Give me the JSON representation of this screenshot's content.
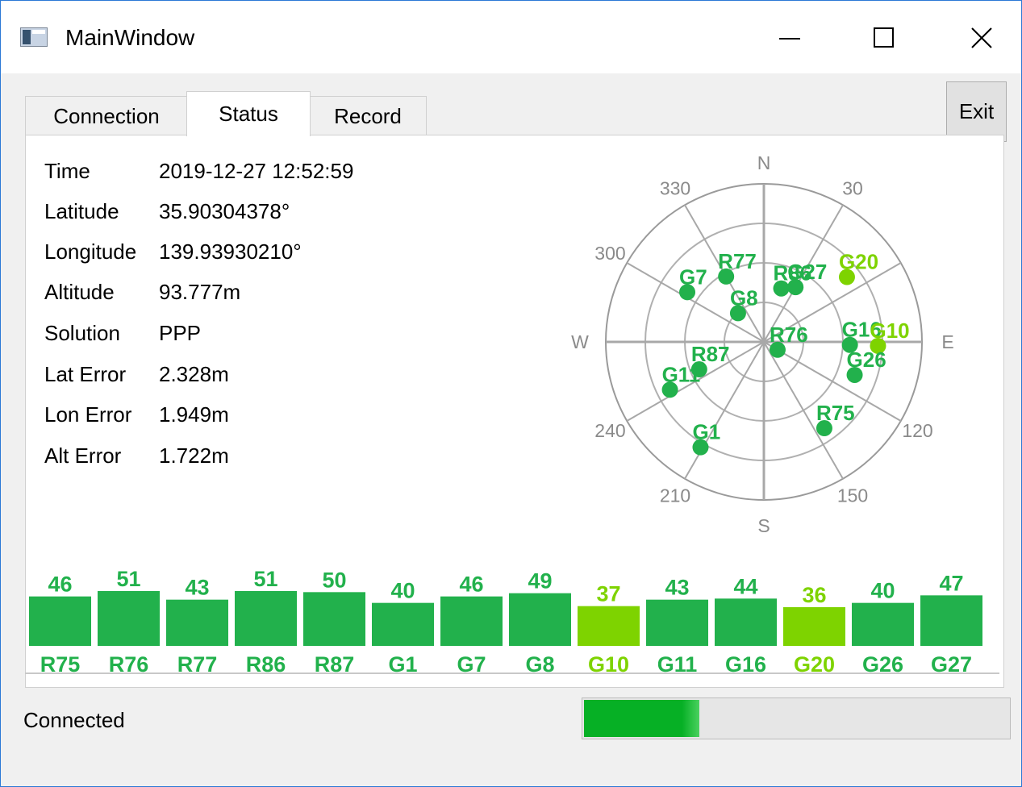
{
  "window": {
    "title": "MainWindow",
    "minimize_icon": "minimize-icon",
    "maximize_icon": "maximize-icon",
    "close_icon": "close-icon"
  },
  "tabs": [
    {
      "label": "Connection",
      "active": false
    },
    {
      "label": "Status",
      "active": true
    },
    {
      "label": "Record",
      "active": false
    }
  ],
  "exit_label": "Exit",
  "info": [
    {
      "label": "Time",
      "value": "2019-12-27 12:52:59"
    },
    {
      "label": "Latitude",
      "value": "35.90304378°"
    },
    {
      "label": "Longitude",
      "value": "139.93930210°"
    },
    {
      "label": "Altitude",
      "value": "93.777m"
    },
    {
      "label": "Solution",
      "value": "PPP"
    },
    {
      "label": "Lat Error",
      "value": "2.328m"
    },
    {
      "label": "Lon Error",
      "value": "1.949m"
    },
    {
      "label": "Alt Error",
      "value": "1.722m"
    }
  ],
  "skyplot": {
    "cardinals": {
      "N": "N",
      "E": "E",
      "S": "S",
      "W": "W"
    },
    "azimuth_labels": [
      "30",
      "120",
      "150",
      "210",
      "240",
      "300",
      "330"
    ],
    "satellites": [
      {
        "name": "R77",
        "az": 330,
        "el": 47,
        "color": "#22b14c"
      },
      {
        "name": "G7",
        "az": 303,
        "el": 38,
        "color": "#22b14c"
      },
      {
        "name": "R86",
        "az": 18,
        "el": 58,
        "color": "#22b14c"
      },
      {
        "name": "G27",
        "az": 30,
        "el": 54,
        "color": "#22b14c"
      },
      {
        "name": "G20",
        "az": 52,
        "el": 30,
        "color": "#7ed300"
      },
      {
        "name": "G8",
        "az": 318,
        "el": 68,
        "color": "#22b14c"
      },
      {
        "name": "G16",
        "az": 92,
        "el": 41,
        "color": "#22b14c"
      },
      {
        "name": "G10",
        "az": 92,
        "el": 25,
        "color": "#7ed300"
      },
      {
        "name": "R76",
        "az": 120,
        "el": 81,
        "color": "#22b14c"
      },
      {
        "name": "G26",
        "az": 110,
        "el": 35,
        "color": "#22b14c"
      },
      {
        "name": "R87",
        "az": 247,
        "el": 50,
        "color": "#22b14c"
      },
      {
        "name": "G11",
        "az": 243,
        "el": 30,
        "color": "#22b14c"
      },
      {
        "name": "R75",
        "az": 145,
        "el": 30,
        "color": "#22b14c"
      },
      {
        "name": "G1",
        "az": 211,
        "el": 20,
        "color": "#22b14c"
      }
    ]
  },
  "chart_data": {
    "type": "bar",
    "categories": [
      "R75",
      "R76",
      "R77",
      "R86",
      "R87",
      "G1",
      "G7",
      "G8",
      "G10",
      "G11",
      "G16",
      "G20",
      "G26",
      "G27"
    ],
    "values": [
      46,
      51,
      43,
      51,
      50,
      40,
      46,
      49,
      37,
      43,
      44,
      36,
      40,
      47
    ],
    "colors": [
      "#22b14c",
      "#22b14c",
      "#22b14c",
      "#22b14c",
      "#22b14c",
      "#22b14c",
      "#22b14c",
      "#22b14c",
      "#7ed300",
      "#22b14c",
      "#22b14c",
      "#7ed300",
      "#22b14c",
      "#22b14c"
    ],
    "ylim": [
      0,
      75
    ]
  },
  "status": {
    "text": "Connected",
    "progress": 0.27
  }
}
